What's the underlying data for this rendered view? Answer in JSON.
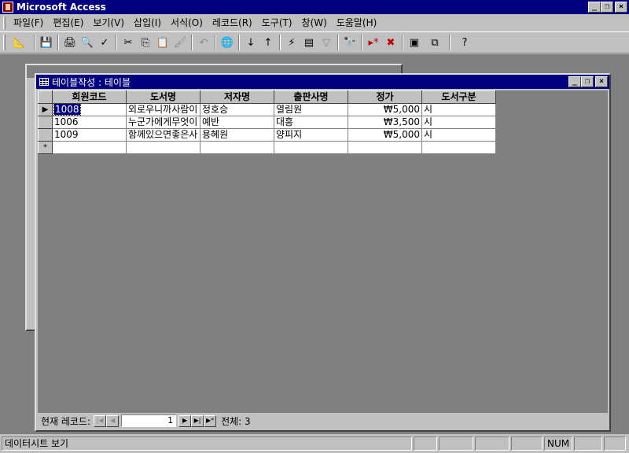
{
  "app": {
    "title": "Microsoft Access"
  },
  "title_buttons": {
    "minimize": "_",
    "restore": "❐",
    "close": "×"
  },
  "menu": [
    "파일(F)",
    "편집(E)",
    "보기(V)",
    "삽입(I)",
    "서식(O)",
    "레코드(R)",
    "도구(T)",
    "창(W)",
    "도움말(H)"
  ],
  "toolbar": {
    "items": [
      {
        "name": "view-design-icon",
        "glyph": "📐"
      },
      {
        "name": "save-icon",
        "glyph": "💾"
      },
      {
        "name": "print-icon",
        "glyph": "🖨"
      },
      {
        "name": "print-preview-icon",
        "glyph": "🔍"
      },
      {
        "name": "spelling-icon",
        "glyph": "✓"
      },
      {
        "name": "cut-icon",
        "glyph": "✂"
      },
      {
        "name": "copy-icon",
        "glyph": "⎘"
      },
      {
        "name": "paste-icon",
        "glyph": "📋"
      },
      {
        "name": "format-painter-icon",
        "glyph": "🖌"
      },
      {
        "name": "undo-icon",
        "glyph": "↶"
      },
      {
        "name": "hyperlink-icon",
        "glyph": "🌐"
      },
      {
        "name": "sort-ascending-icon",
        "glyph": "↓"
      },
      {
        "name": "sort-descending-icon",
        "glyph": "↑"
      },
      {
        "name": "filter-by-selection-icon",
        "glyph": "⚡"
      },
      {
        "name": "filter-by-form-icon",
        "glyph": "▤"
      },
      {
        "name": "apply-filter-icon",
        "glyph": "▽"
      },
      {
        "name": "find-icon",
        "glyph": "🔭"
      },
      {
        "name": "new-record-icon",
        "glyph": "▸*"
      },
      {
        "name": "delete-record-icon",
        "glyph": "✖"
      },
      {
        "name": "database-window-icon",
        "glyph": "▣"
      },
      {
        "name": "new-object-icon",
        "glyph": "⧉"
      },
      {
        "name": "help-icon",
        "glyph": "?"
      }
    ]
  },
  "table_window": {
    "title": "테이블작성 : 테이블",
    "columns": [
      "회원코드",
      "도서명",
      "저자명",
      "출판사명",
      "정가",
      "도서구분"
    ],
    "rows": [
      [
        "1008",
        "외로우니까사람이",
        "정호승",
        "열림원",
        "₩5,000",
        "시"
      ],
      [
        "1006",
        "누군가에게무엇이",
        "예반",
        "대흥",
        "₩3,500",
        "시"
      ],
      [
        "1009",
        "함께있으면좋은사",
        "용혜원",
        "양피지",
        "₩5,000",
        "시"
      ]
    ],
    "new_row_marker": "*",
    "current_row_marker": "▶",
    "navigator": {
      "label": "현재 레코드:",
      "current": "1",
      "total_label": "전체: 3",
      "first": "|◀",
      "prev": "◀",
      "next": "▶",
      "last": "▶|",
      "new": "▶*"
    }
  },
  "statusbar": {
    "text": "데이터시트 보기",
    "num": "NUM"
  }
}
